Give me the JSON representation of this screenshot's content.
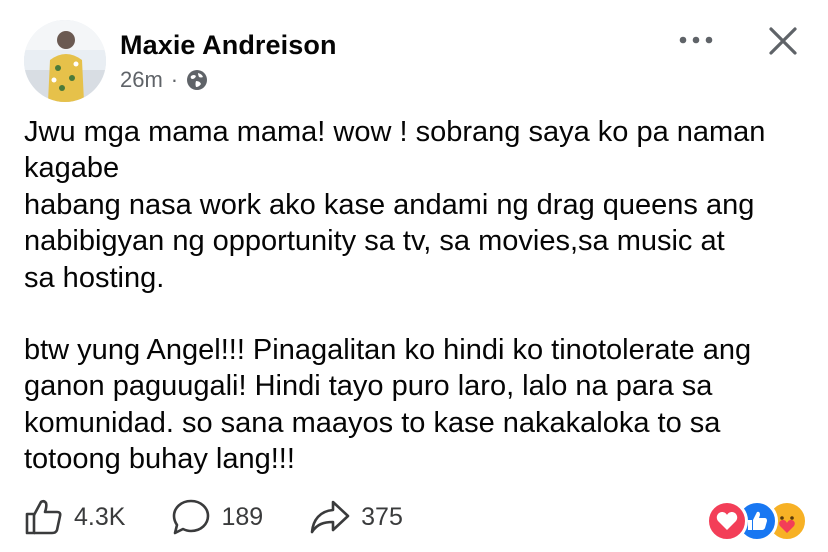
{
  "post": {
    "author": "Maxie Andreison",
    "timestamp": "26m",
    "separator": "·",
    "audience_icon": "globe-icon",
    "menu_icon": "more-dots-icon",
    "close_icon": "close-icon",
    "text": {
      "lines_para1": [
        "Jwu mga mama mama! wow ! sobrang saya ko pa naman",
        "kagabe",
        "habang nasa work ako kase andami ng drag queens ang",
        "nabibigyan ng opportunity sa tv, sa movies,sa music at",
        "sa hosting."
      ],
      "lines_para2": [
        "btw yung Angel!!! Pinagalitan ko hindi ko tinotolerate ang",
        "ganon paguugali! Hindi tayo puro laro, lalo na para sa",
        "komunidad. so sana maayos to kase nakakaloka to sa",
        "totoong buhay lang!!!"
      ]
    }
  },
  "footer": {
    "likes": "4.3K",
    "comments": "189",
    "shares": "375",
    "reactions": [
      "love-reaction-icon",
      "like-reaction-icon",
      "care-reaction-icon"
    ]
  },
  "colors": {
    "text": "#050505",
    "secondary": "#5f6368",
    "like_blue": "#1877f2",
    "love_red": "#f33e58",
    "care_yellow": "#f7b125"
  }
}
